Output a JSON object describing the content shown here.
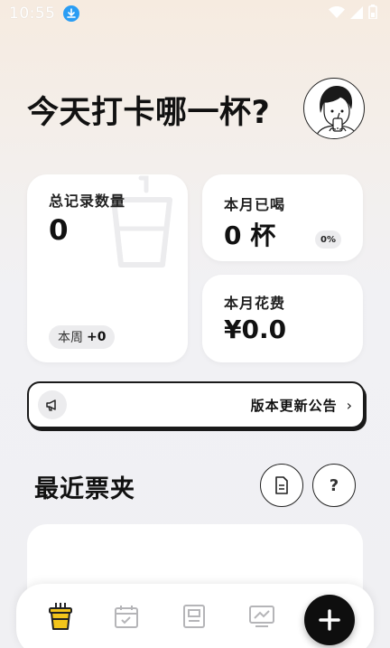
{
  "status_bar": {
    "time": "10:55"
  },
  "header": {
    "title": "今天打卡哪一杯?"
  },
  "stats": {
    "total": {
      "label": "总记录数量",
      "value": "0",
      "week_label": "本周",
      "week_value": "+0"
    },
    "month": {
      "label": "本月已喝",
      "value": "0 杯",
      "percent": "0%"
    },
    "spend": {
      "label": "本月花费",
      "value": "¥0.0"
    }
  },
  "announcement": {
    "text": "版本更新公告"
  },
  "recent": {
    "title": "最近票夹",
    "help_label": "?"
  },
  "tabbar": {
    "tabs": [
      {
        "icon": "drink-cup-icon",
        "active": true
      },
      {
        "icon": "calendar-check-icon",
        "active": false
      },
      {
        "icon": "receipt-icon",
        "active": false
      },
      {
        "icon": "chart-monitor-icon",
        "active": false
      }
    ],
    "add_icon": "plus-icon"
  },
  "colors": {
    "accent_yellow": "#f3c51b",
    "dark": "#0e0e0e",
    "download_badge": "#2a9df4"
  }
}
